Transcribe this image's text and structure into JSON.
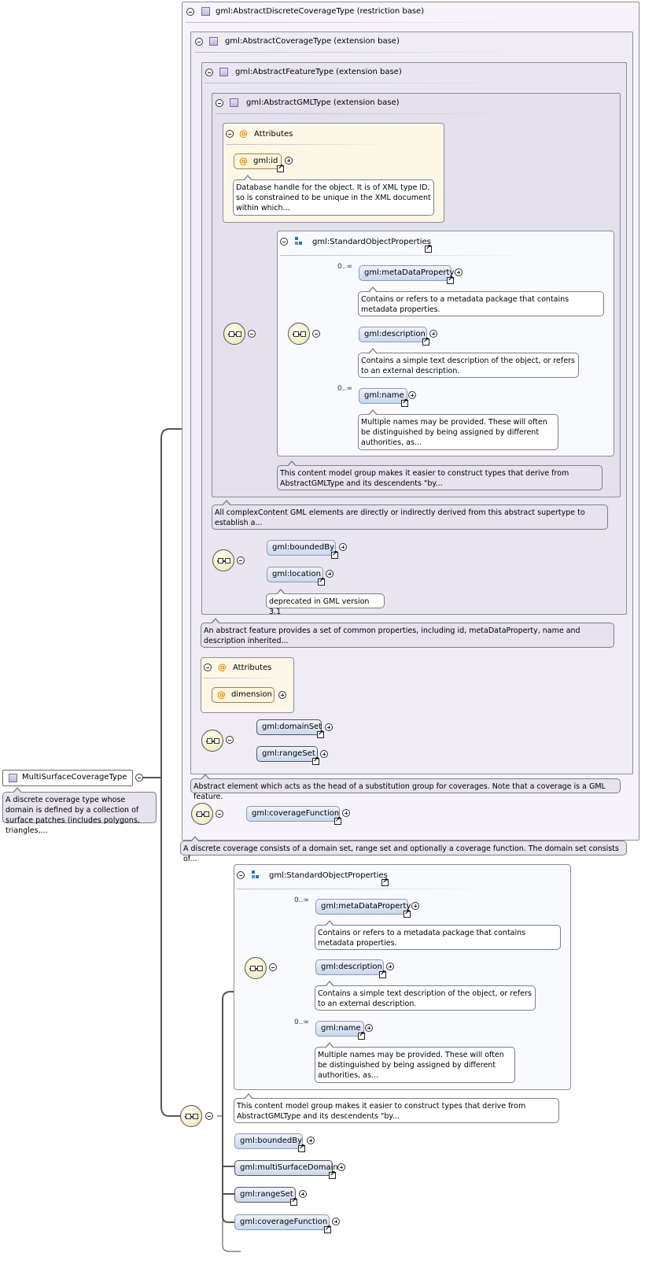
{
  "root": {
    "name": "MultiSurfaceCoverageType",
    "annotation": "A discrete coverage type whose domain is defined by a collection of surface patches (includes polygons, triangles,..."
  },
  "base_discrete": {
    "header": "gml:AbstractDiscreteCoverageType (restriction base)",
    "annotation": "A discrete coverage consists of a domain set, range set and optionally a coverage function. The domain set consists of..."
  },
  "base_coverage": {
    "header": "gml:AbstractCoverageType (extension base)",
    "annotation": "Abstract element which acts as the head of a substitution group for coverages. Note that a coverage is a GML feature."
  },
  "base_feature": {
    "header": "gml:AbstractFeatureType (extension base)",
    "annotation": "An abstract feature provides a set of common properties, including id, metaDataProperty, name and description inherited..."
  },
  "base_gml": {
    "header": "gml:AbstractGMLType (extension base)",
    "annotation": "All complexContent GML elements are directly or indirectly derived from this abstract supertype to establish a..."
  },
  "attributes_gml": {
    "header": "Attributes",
    "id_label": "gml:id",
    "id_annotation": "Database handle for the object. It is of XML type ID, so is constrained to be unique in the XML document within which..."
  },
  "std_props_top": {
    "header": "gml:StandardObjectProperties",
    "metadata": "gml:metaDataProperty",
    "metadata_card": "0..∞",
    "metadata_ann": "Contains or refers to a metadata package that contains metadata properties.",
    "description": "gml:description",
    "description_ann": "Contains a simple text description of the object, or refers to an external description.",
    "name": "gml:name",
    "name_card": "0..∞",
    "name_ann": "Multiple names may be provided. These will often be distinguished by being assigned by different authorities, as...",
    "group_ann": "This content model group makes it easier to construct types that derive from AbstractGMLType and its descendents \"by..."
  },
  "feature_seq": {
    "bounded_by": "gml:boundedBy",
    "location": "gml:location",
    "location_ann": "deprecated in GML version 3.1"
  },
  "attributes_cov": {
    "header": "Attributes",
    "dimension": "dimension"
  },
  "coverage_seq": {
    "domain_set": "gml:domainSet",
    "range_set": "gml:rangeSet"
  },
  "discrete_seq": {
    "coverage_function": "gml:coverageFunction"
  },
  "std_props_bottom": {
    "header": "gml:StandardObjectProperties",
    "metadata": "gml:metaDataProperty",
    "metadata_card": "0..∞",
    "metadata_ann": "Contains or refers to a metadata package that contains metadata properties.",
    "description": "gml:description",
    "description_ann": "Contains a simple text description of the object, or refers to an external description.",
    "name": "gml:name",
    "name_card": "0..∞",
    "name_ann": "Multiple names may be provided. These will often be distinguished by being assigned by different authorities, as...",
    "group_ann": "This content model group makes it easier to construct types that derive from AbstractGMLType and its descendents \"by..."
  },
  "bottom_seq": {
    "bounded_by": "gml:boundedBy",
    "multi_surface_domain": "gml:multiSurfaceDomain",
    "range_set": "gml:rangeSet",
    "coverage_function": "gml:coverageFunction"
  },
  "colors": {
    "element_fill": "#c9d8ee",
    "attribute_fill": "#fdf7e8",
    "sequence_fill": "#ece4b0",
    "frame_border": "#8f8f97",
    "attribute_icon": "#e08a00",
    "group_icon": "#2f6fb8"
  }
}
